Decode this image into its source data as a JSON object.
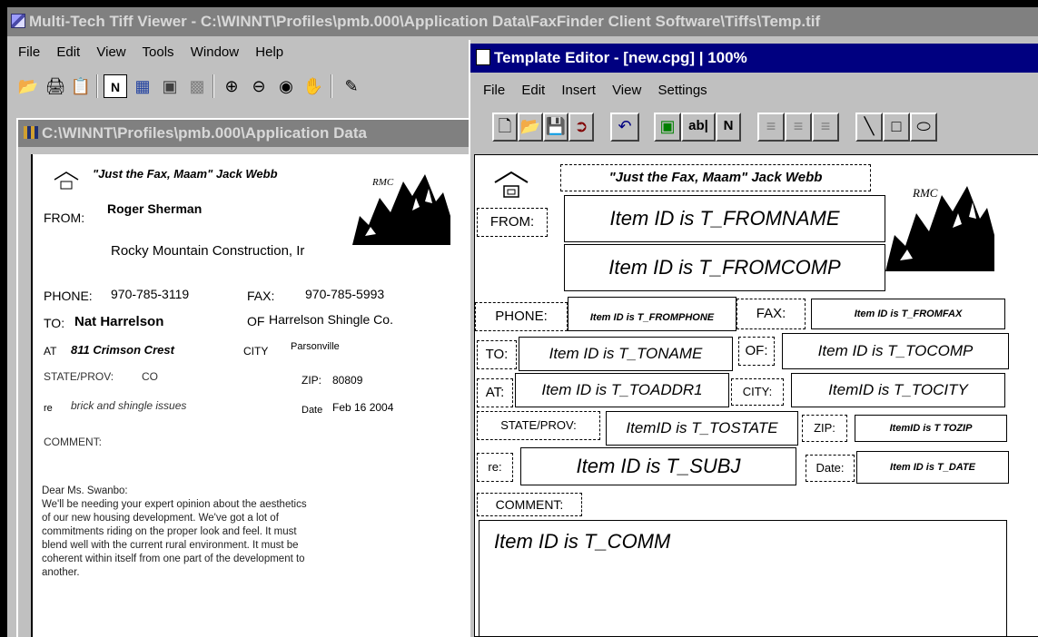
{
  "tiff_viewer": {
    "title": "Multi-Tech Tiff Viewer - C:\\WINNT\\Profiles\\pmb.000\\Application Data\\FaxFinder Client Software\\Tiffs\\Temp.tif",
    "menu": [
      "File",
      "Edit",
      "View",
      "Tools",
      "Window",
      "Help"
    ],
    "toolbar_icons": [
      "open-folder-icon",
      "print-icon",
      "copy-icon",
      "normal-view-icon",
      "page-view-icon",
      "thumbnail-view-icon",
      "fit-view-icon",
      "zoom-in-icon",
      "zoom-out-icon",
      "zoom-fit-icon",
      "pan-hand-icon",
      "annotate-icon"
    ],
    "document": {
      "title": "C:\\WINNT\\Profiles\\pmb.000\\Application Data",
      "slogan": "\"Just the Fax, Maam\" Jack Webb",
      "logo_text": "RMC",
      "from_label": "FROM:",
      "from_name": "Roger Sherman",
      "from_company": "Rocky Mountain Construction, Ir",
      "phone_label": "PHONE:",
      "phone": "970-785-3119",
      "fax_label": "FAX:",
      "fax": "970-785-5993",
      "to_label": "TO:",
      "to_name": "Nat Harrelson",
      "of_label": "OF",
      "to_company": "Harrelson Shingle Co.",
      "at_label": "AT",
      "to_address": "811 Crimson Crest",
      "city_label": "CITY",
      "city": "Parsonville",
      "state_label": "STATE/PROV:",
      "state": "CO",
      "zip_label": "ZIP:",
      "zip": "80809",
      "re_label": "re",
      "subject": "brick and shingle issues",
      "date_label": "Date",
      "date": "Feb 16 2004",
      "comment_label": "COMMENT:",
      "letter_lines": [
        "Dear Ms. Swanbo:",
        " We'll be needing your expert opinion about the aesthetics",
        "of our new housing development. We've got a lot of",
        "commitments riding on the proper look and feel. It must",
        "blend well with the current rural environment. It must be",
        "coherent within itself from one part of the development to",
        "another."
      ]
    }
  },
  "template_editor": {
    "title": "Template Editor - [new.cpg] | 100%",
    "menu": [
      "File",
      "Edit",
      "Insert",
      "View",
      "Settings"
    ],
    "toolbar_icons": [
      "new-icon",
      "open-icon",
      "save-icon",
      "exit-icon",
      "undo-icon",
      "insert-image-icon",
      "insert-text-icon",
      "insert-field-icon",
      "align-left-icon",
      "align-center-icon",
      "align-right-icon",
      "line-icon",
      "rectangle-icon",
      "ellipse-icon"
    ],
    "toolbar_text": {
      "text_tool": "ab|",
      "field_tool": "N"
    },
    "canvas": {
      "slogan": "\"Just the Fax, Maam\" Jack Webb",
      "logo_text": "RMC",
      "labels": {
        "from": "FROM:",
        "phone": "PHONE:",
        "fax": "FAX:",
        "to": "TO:",
        "of": "OF:",
        "at": "AT:",
        "city": "CITY:",
        "state": "STATE/PROV:",
        "zip": "ZIP:",
        "re": "re:",
        "date": "Date:",
        "comment": "COMMENT:"
      },
      "fields": {
        "fromname": "Item ID is T_FROMNAME",
        "fromcomp": "Item ID is T_FROMCOMP",
        "fromphone": "Item ID is  T_FROMPHONE",
        "fromfax": "Item ID is T_FROMFAX",
        "toname": "Item ID is T_TONAME",
        "tocomp": "Item ID is T_TOCOMP",
        "toaddr1": "Item ID is T_TOADDR1",
        "tocity": "ItemID is T_TOCITY",
        "tostate": "ItemID is T_TOSTATE",
        "tozip": "ItemID is T TOZIP",
        "subj": "Item ID is T_SUBJ",
        "date": "Item ID is T_DATE",
        "comm": "Item ID is T_COMM"
      }
    }
  }
}
